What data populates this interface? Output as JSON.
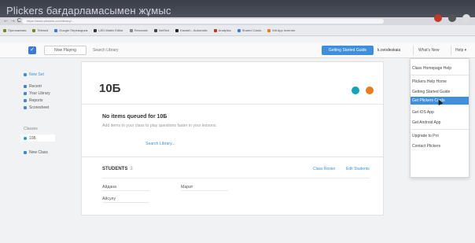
{
  "video_title": "Plickers бағдарламасымен жұмыс",
  "browser": {
    "nav_arrows": "← → C ⌂",
    "url": "https://www.plickers.com/library/...",
    "bookmarks": [
      "Приложения",
      "Telesеd",
      "Google Переводчик",
      "LED Matrix Editor",
      "Renovate",
      "NetSed",
      "Kazakh - Automatic",
      "Analytics",
      "Shared Cards",
      "Mit App Inventor"
    ]
  },
  "app": {
    "now_playing": "Now Playing",
    "search_placeholder": "Search Library",
    "getting_started": "Getting Started Guide",
    "username": "k.ovodeskaia",
    "whats_new": "What's New",
    "help": "Help ▾"
  },
  "sidebar": {
    "new_set": "New Set",
    "recent": "Recent",
    "your_library": "Your Library",
    "reports": "Reports",
    "scoresheet": "Scoresheet",
    "classes_heading": "Classes",
    "active_class": "10Б",
    "new_class": "New Class"
  },
  "main": {
    "class_title": "10Б",
    "no_items": "No items queued for 10Б",
    "add_items": "Add items to your class to play questions faster in your lessons.",
    "search_library": "Search Library...",
    "students_label": "STUDENTS",
    "students_count": "3",
    "class_roster": "Class Roster",
    "edit_students": "Edit Students",
    "students": [
      "Айдана",
      "Марат",
      "Айсулу"
    ]
  },
  "help_menu": {
    "items": [
      "Class Homepage Help",
      "Plickers Help Home",
      "Getting Started Guide",
      "Get Plickers Cards",
      "Get iOS App",
      "Get Android App",
      "Upgrade to Pro",
      "Contact Plickers"
    ],
    "highlighted": "Get Plickers Cards"
  },
  "colors": {
    "accent": "#3f8fdc",
    "logo": "#3a7bd5",
    "icon_teal": "#17a2b8",
    "icon_orange": "#e67e22"
  }
}
